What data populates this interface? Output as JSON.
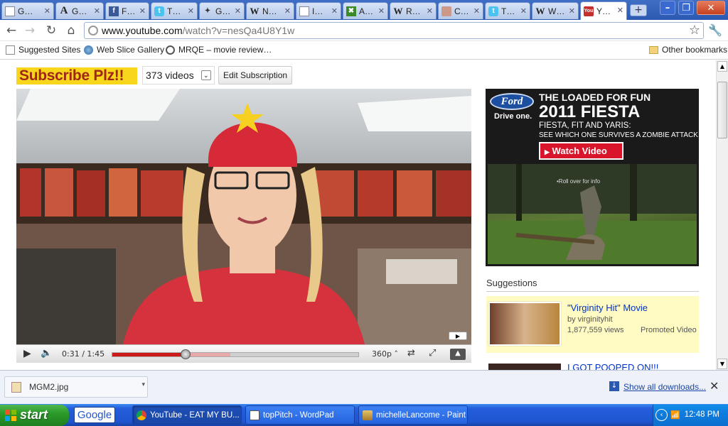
{
  "browser": {
    "tabs": [
      {
        "label": "G…",
        "icon": "page-icon"
      },
      {
        "label": "G…",
        "icon": "ask-icon"
      },
      {
        "label": "F…",
        "icon": "facebook-icon"
      },
      {
        "label": "T…",
        "icon": "twitter-icon"
      },
      {
        "label": "G…",
        "icon": "bird-icon"
      },
      {
        "label": "N…",
        "icon": "wikipedia-icon"
      },
      {
        "label": "I…",
        "icon": "page-icon"
      },
      {
        "label": "A…",
        "icon": "green-app-icon"
      },
      {
        "label": "R…",
        "icon": "wikipedia-icon"
      },
      {
        "label": "C…",
        "icon": "photo-icon"
      },
      {
        "label": "T…",
        "icon": "twitter-icon"
      },
      {
        "label": "W…",
        "icon": "wikipedia-icon"
      },
      {
        "label": "Y…",
        "icon": "youtube-icon"
      }
    ],
    "new_tab_label": "+",
    "url_host": "www.youtube.com",
    "url_path": "/watch?v=nesQa4U8Y1w",
    "bookmarks": [
      {
        "label": "Suggested Sites"
      },
      {
        "label": "Web Slice Gallery"
      },
      {
        "label": "MRQE – movie review…"
      }
    ],
    "other_bookmarks": "Other bookmarks"
  },
  "page": {
    "channel_logo": "Subscribe Plz!!",
    "video_count": "373 videos",
    "edit_subscription": "Edit Subscription",
    "player": {
      "time": "0:31 / 1:45",
      "quality": "360p",
      "progress_played": 0.297,
      "progress_buffered": 0.48
    },
    "ad": {
      "brand": "Ford",
      "tagline": "Drive one.",
      "headline1": "THE LOADED FOR FUN",
      "headline2": "2011 FIESTA",
      "headline3": "FIESTA, FIT AND YARIS:",
      "headline4": "SEE WHICH ONE SURVIVES A ZOMBIE ATTACK",
      "button": "Watch Video",
      "rollover": "•Roll over for info"
    },
    "suggestions_title": "Suggestions",
    "suggestions": [
      {
        "title": "\"Virginity Hit\" Movie",
        "by": "by virginityhit",
        "views": "1,877,559 views",
        "promoted": "Promoted Video"
      },
      {
        "title": "I GOT POOPED ON!!!"
      }
    ]
  },
  "downloads": {
    "file": "MGM2.jpg",
    "show_all": "Show all downloads..."
  },
  "taskbar": {
    "start": "start",
    "google": "Google",
    "tasks": [
      {
        "label": "YouTube - EAT MY BU..."
      },
      {
        "label": "topPitch - WordPad"
      },
      {
        "label": "michelleLancome - Paint"
      }
    ],
    "clock": "12:48 PM"
  }
}
